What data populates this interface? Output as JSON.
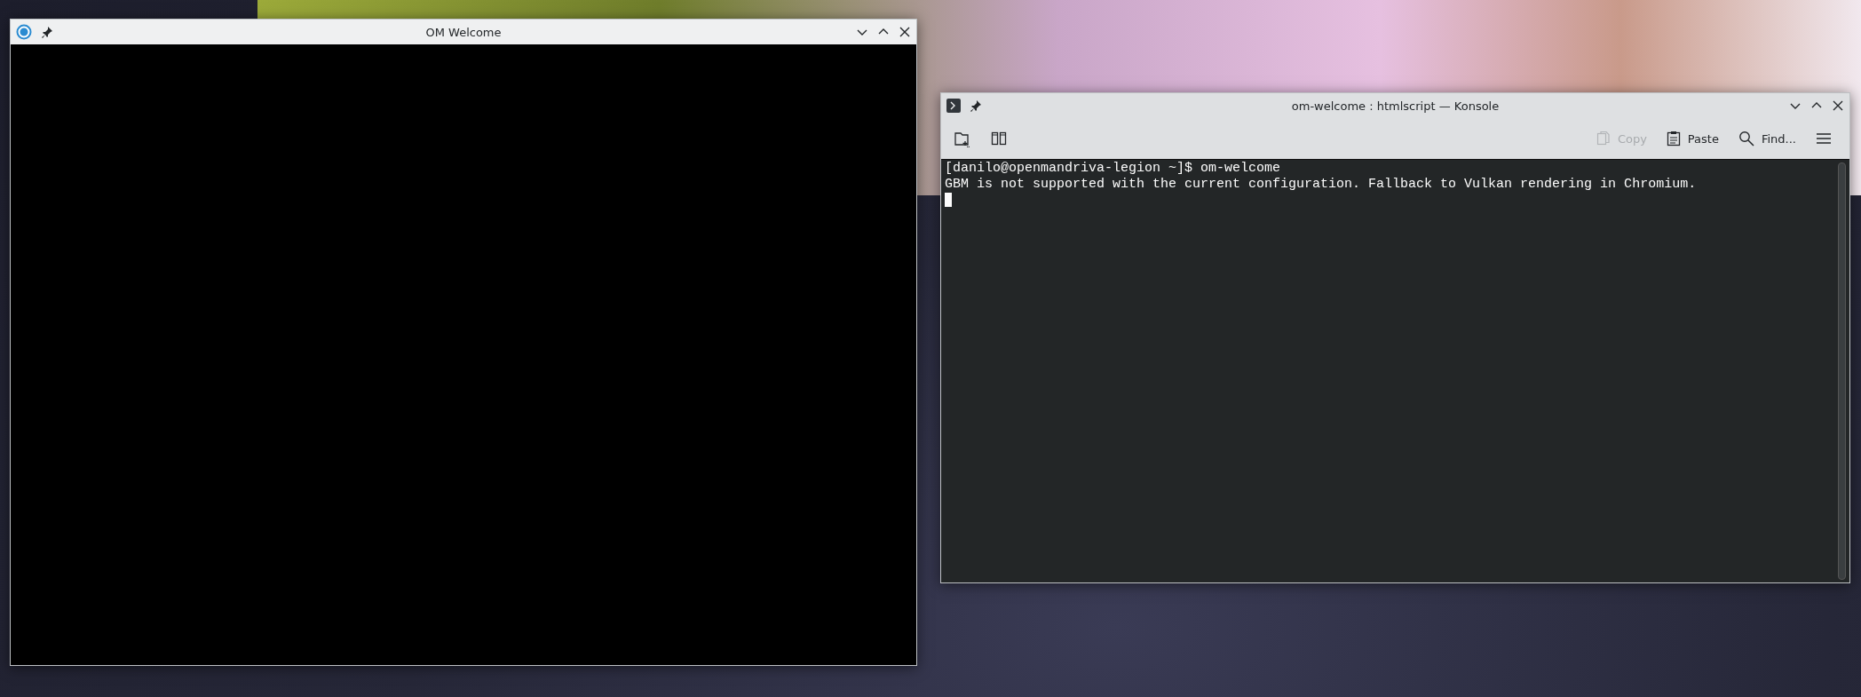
{
  "windows": [
    {
      "kind": "app",
      "title": "OM Welcome"
    },
    {
      "kind": "terminal",
      "title": "om-welcome : htmlscript — Konsole",
      "toolbar": [
        {
          "kind": "new-tab",
          "disabled": false
        },
        {
          "kind": "split",
          "disabled": false
        },
        {
          "kind": "copy",
          "label": "Copy",
          "disabled": true
        },
        {
          "kind": "paste",
          "label": "Paste",
          "disabled": false
        },
        {
          "kind": "find",
          "label": "Find...",
          "disabled": false
        },
        {
          "kind": "menu",
          "disabled": false
        }
      ],
      "lines": [
        "[danilo@openmandriva-legion ~]$ om-welcome",
        "GBM is not supported with the current configuration. Fallback to Vulkan rendering in Chromium."
      ]
    }
  ]
}
